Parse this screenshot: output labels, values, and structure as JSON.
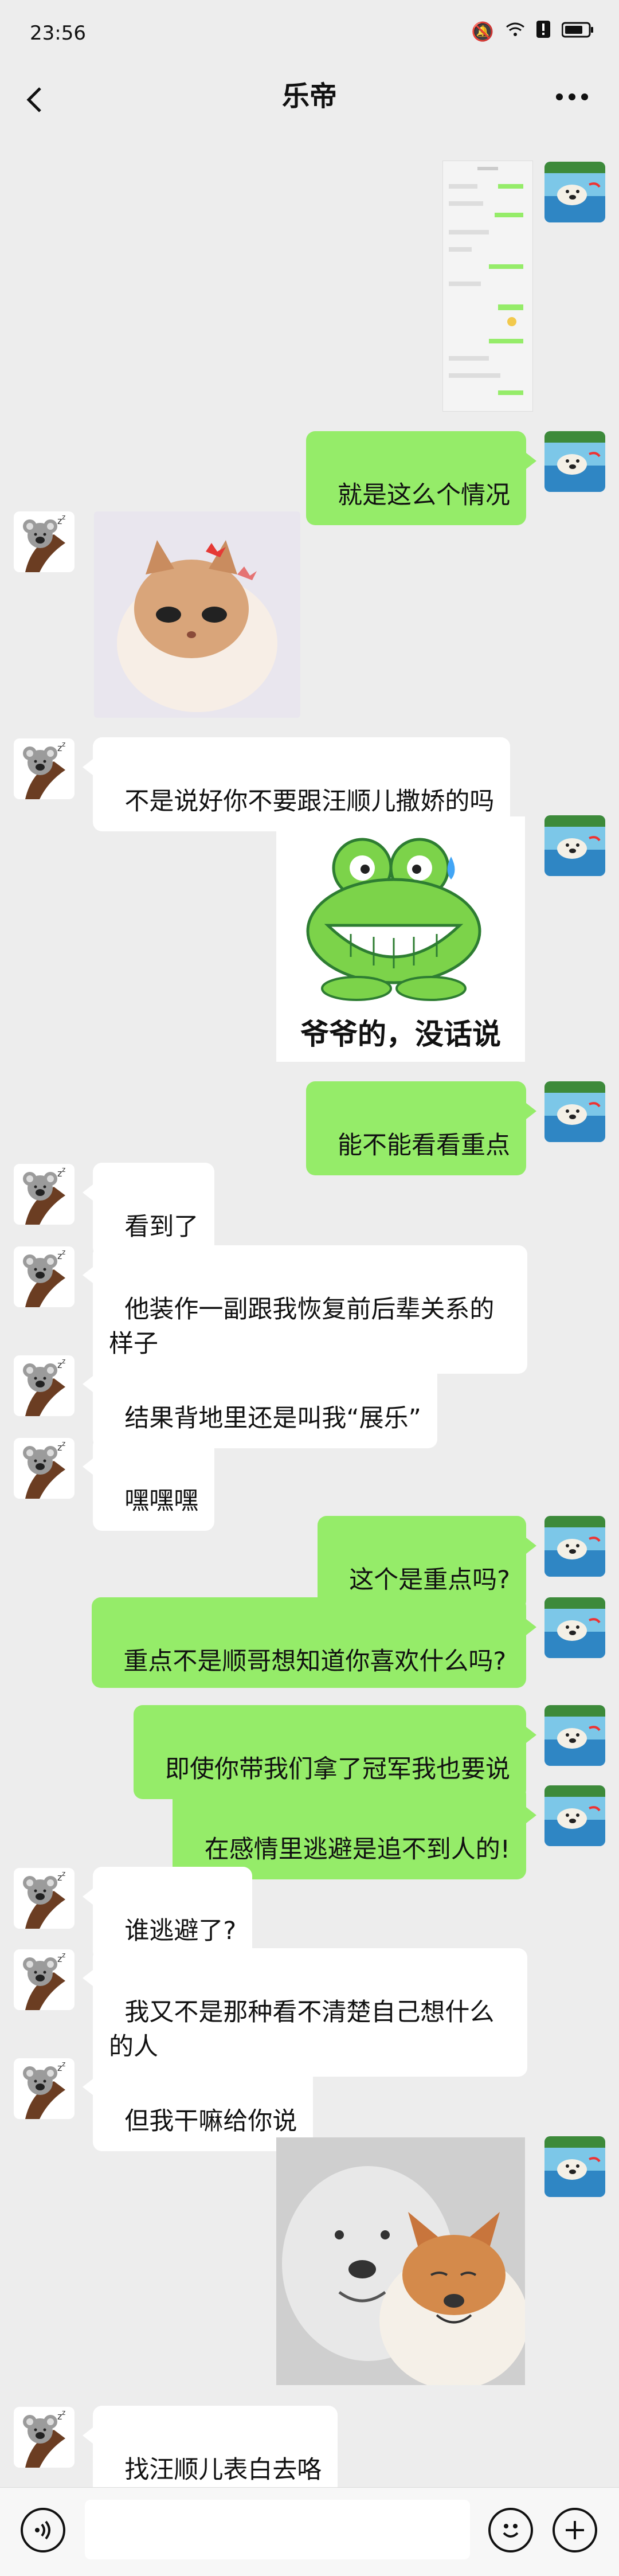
{
  "status": {
    "time": "23:56",
    "icons": [
      "mute-icon",
      "wifi-icon",
      "alert-icon",
      "battery-icon"
    ]
  },
  "header": {
    "title": "乐帝",
    "back_icon": "chevron-left-icon",
    "more_icon": "more-icon"
  },
  "messages": [
    {
      "from": "me",
      "type": "image",
      "content": "screenshot-image"
    },
    {
      "from": "me",
      "type": "text",
      "text": "就是这么个情况"
    },
    {
      "from": "other",
      "type": "image",
      "content": "cat-sticker"
    },
    {
      "from": "other",
      "type": "text",
      "text": "不是说好你不要跟汪顺儿撒娇的吗"
    },
    {
      "from": "me",
      "type": "image",
      "content": "frog-sticker",
      "caption": "爷爷的，没话说"
    },
    {
      "from": "me",
      "type": "text",
      "text": "能不能看看重点"
    },
    {
      "from": "other",
      "type": "text",
      "text": "看到了"
    },
    {
      "from": "other",
      "type": "text",
      "text": "他装作一副跟我恢复前后辈关系的\n样子"
    },
    {
      "from": "other",
      "type": "text",
      "text": "结果背地里还是叫我“展乐”"
    },
    {
      "from": "other",
      "type": "text",
      "text": "嘿嘿嘿"
    },
    {
      "from": "me",
      "type": "text",
      "text": "这个是重点吗?"
    },
    {
      "from": "me",
      "type": "text",
      "text": "重点不是顺哥想知道你喜欢什么吗?"
    },
    {
      "from": "me",
      "type": "text",
      "text": "即使你带我们拿了冠军我也要说"
    },
    {
      "from": "me",
      "type": "text",
      "text": "在感情里逃避是追不到人的!"
    },
    {
      "from": "other",
      "type": "text",
      "text": "谁逃避了?"
    },
    {
      "from": "other",
      "type": "text",
      "text": "我又不是那种看不清楚自己想什么\n的人"
    },
    {
      "from": "other",
      "type": "text",
      "text": "但我干嘛给你说"
    },
    {
      "from": "me",
      "type": "image",
      "content": "dogs-sticker"
    },
    {
      "from": "other",
      "type": "text",
      "text": "找汪顺儿表白去咯"
    }
  ],
  "input_bar": {
    "voice_icon": "voice-icon",
    "emoji_icon": "emoji-icon",
    "plus_icon": "plus-icon"
  }
}
